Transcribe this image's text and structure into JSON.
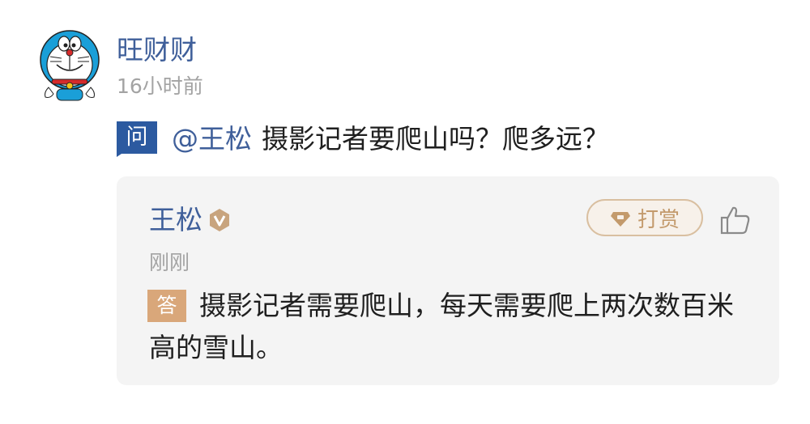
{
  "post": {
    "author_name": "旺财财",
    "time": "16小时前",
    "avatar_icon": "doraemon-avatar"
  },
  "question": {
    "badge": "问",
    "mention": "@王松",
    "text": "摄影记者要爬山吗？爬多远？"
  },
  "answer": {
    "answerer_name": "王松",
    "verified_icon": "verified-v-icon",
    "tip_label": "打赏",
    "tip_icon": "gem-icon",
    "like_icon": "thumbs-up-icon",
    "time": "刚刚",
    "badge": "答",
    "text": "摄影记者需要爬山，每天需要爬上两次数百米高的雪山。"
  },
  "colors": {
    "link_blue": "#3f5f9a",
    "question_badge": "#2c5aa0",
    "answer_badge": "#d9a77a",
    "tip_gold": "#c39a6c",
    "card_bg": "#f4f4f4",
    "meta_gray": "#a3a3a3"
  }
}
